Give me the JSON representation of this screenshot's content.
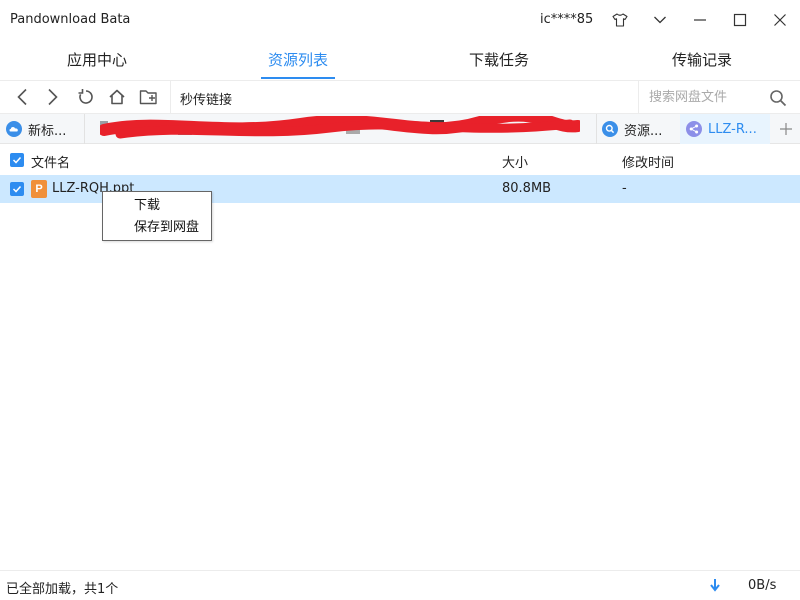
{
  "window": {
    "title": "Pandownload Bata",
    "user": "ic****85"
  },
  "main_tabs": [
    {
      "label": "应用中心",
      "active": false
    },
    {
      "label": "资源列表",
      "active": true
    },
    {
      "label": "下载任务",
      "active": false
    },
    {
      "label": "传输记录",
      "active": false
    }
  ],
  "toolbar": {
    "instant_link": "秒传链接",
    "search_placeholder": "搜索网盘文件"
  },
  "resource_tabs": [
    {
      "label": "新标...",
      "icon": "cloud-icon"
    },
    {
      "label": "资源...",
      "icon": "search-icon"
    },
    {
      "label": "LLZ-R...",
      "icon": "share-icon",
      "active": true
    }
  ],
  "list": {
    "headers": {
      "name": "文件名",
      "size": "大小",
      "modified": "修改时间"
    },
    "rows": [
      {
        "name": "LLZ-RQH.ppt",
        "size": "80.8MB",
        "modified": "-",
        "icon_letter": "P",
        "checked": true
      }
    ]
  },
  "context_menu": {
    "items": [
      "下载",
      "保存到网盘"
    ]
  },
  "status": {
    "text": "已全部加载，共1个",
    "speed": "0B/s"
  },
  "colors": {
    "accent": "#2d8cf0",
    "selected_row": "#cce8ff",
    "ppt_icon": "#f0903a",
    "redaction": "#e8212a"
  }
}
